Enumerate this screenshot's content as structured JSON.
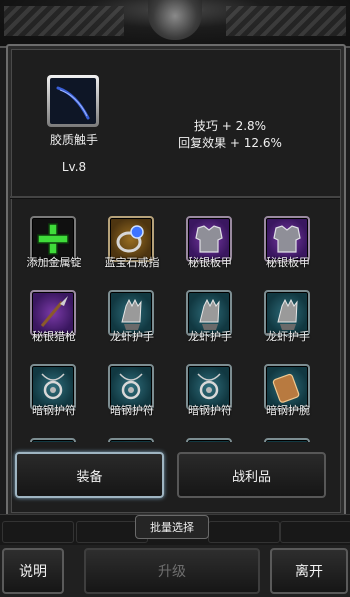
{
  "item": {
    "name": "胶质触手",
    "level": "Lv.8",
    "icon": "tentacle-icon",
    "stats": [
      "技巧 + 2.8%",
      "回复效果 + 12.6%"
    ]
  },
  "inventory": [
    {
      "label": "添加金属锭",
      "icon": "green-plus-icon",
      "rarity": "dark"
    },
    {
      "label": "蓝宝石戒指",
      "icon": "sapphire-ring-icon",
      "rarity": "gold"
    },
    {
      "label": "秘银板甲",
      "icon": "plate-armor-icon",
      "rarity": "purple"
    },
    {
      "label": "秘银板甲",
      "icon": "plate-armor-icon",
      "rarity": "purple"
    },
    {
      "label": "秘银猎枪",
      "icon": "spear-icon",
      "rarity": "purple"
    },
    {
      "label": "龙虾护手",
      "icon": "gauntlet-icon",
      "rarity": "teal"
    },
    {
      "label": "龙虾护手",
      "icon": "gauntlet-icon",
      "rarity": "teal"
    },
    {
      "label": "龙虾护手",
      "icon": "gauntlet-icon",
      "rarity": "teal"
    },
    {
      "label": "暗钢护符",
      "icon": "amulet-icon",
      "rarity": "teal"
    },
    {
      "label": "暗钢护符",
      "icon": "amulet-icon",
      "rarity": "teal"
    },
    {
      "label": "暗钢护符",
      "icon": "amulet-icon",
      "rarity": "teal"
    },
    {
      "label": "暗钢护腕",
      "icon": "bracer-icon",
      "rarity": "teal"
    }
  ],
  "tabs": {
    "equip": "装备",
    "loot": "战利品"
  },
  "batch_select": "批量选择",
  "bottom": {
    "info": "说明",
    "upgrade": "升级",
    "leave": "离开"
  },
  "colors": {
    "purple": "#7b3aa8",
    "teal": "#2f6e7c",
    "gold": "#9a6f22",
    "active_border": "#9fb5c2"
  }
}
